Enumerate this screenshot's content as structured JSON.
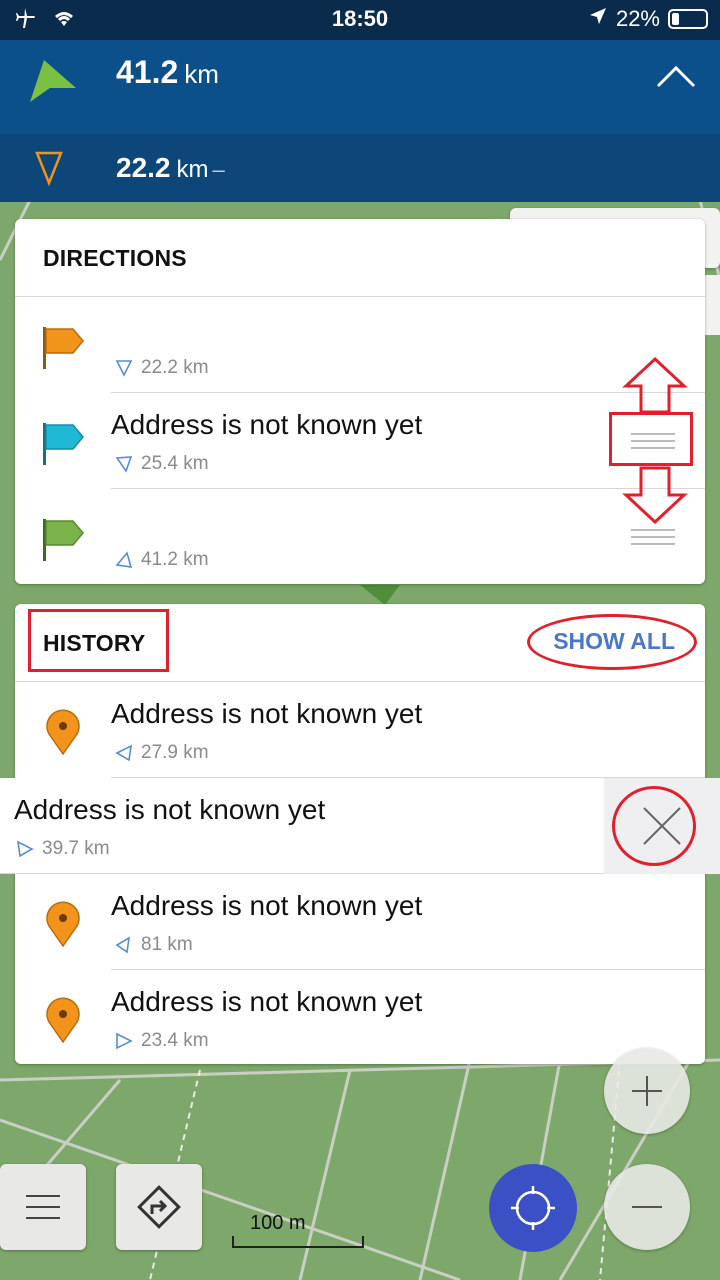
{
  "status_bar": {
    "time": "18:50",
    "battery": "22%"
  },
  "navigation": {
    "total_distance": "41.2",
    "total_unit": "km",
    "next_distance": "22.2",
    "next_unit": "km",
    "next_suffix": "–"
  },
  "directions": {
    "title": "DIRECTIONS",
    "items": [
      {
        "flag_color": "#f2931b",
        "address": "",
        "distance": "22.2 km"
      },
      {
        "flag_color": "#1fb8d6",
        "address": "Address is not known yet",
        "distance": "25.4 km"
      },
      {
        "flag_color": "#7bb24a",
        "address": "",
        "distance": "41.2 km"
      }
    ]
  },
  "history": {
    "title": "HISTORY",
    "show_all": "SHOW ALL",
    "items": [
      {
        "address": "Address is not known yet",
        "distance": "27.9 km"
      },
      {
        "address": "Address is not known yet",
        "distance": "39.7 km"
      },
      {
        "address": "Address is not known yet",
        "distance": "81 km"
      },
      {
        "address": "Address is not known yet",
        "distance": "23.4 km"
      }
    ]
  },
  "map": {
    "scale_label": "100 m"
  },
  "colors": {
    "header": "#0b4f8b",
    "accent": "#4a78c8",
    "annotation": "#e0202a",
    "locate": "#3a50c4"
  }
}
